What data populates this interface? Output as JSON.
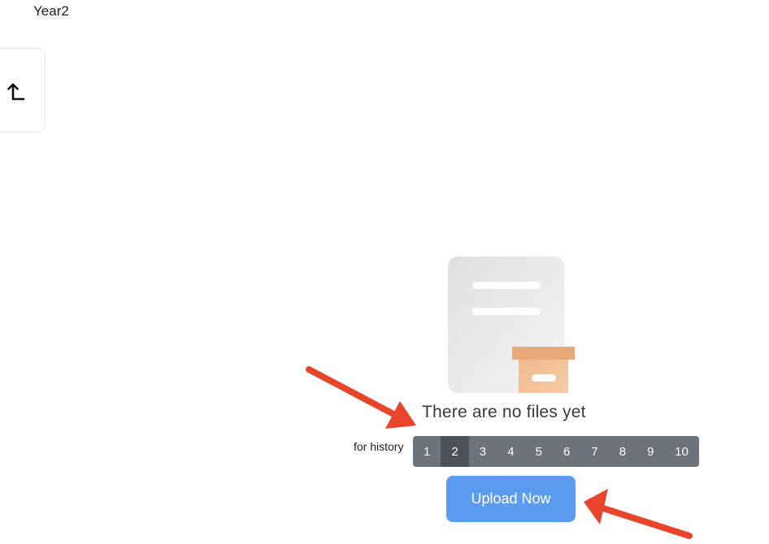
{
  "header": {
    "folder_title": "Year2"
  },
  "nav": {
    "back_icon": "arrow-up-left-icon"
  },
  "empty_state": {
    "icon": "empty-folder-box-icon",
    "message": "There are no files yet"
  },
  "history": {
    "label": "for history",
    "items": [
      "1",
      "2",
      "3",
      "4",
      "5",
      "6",
      "7",
      "8",
      "9",
      "10"
    ],
    "active": "2"
  },
  "actions": {
    "upload_label": "Upload Now"
  },
  "colors": {
    "accent": "#5b9cf0",
    "history_bar": "#6e7379",
    "history_active": "#4d5258",
    "annotation_arrow": "#e8452c"
  }
}
